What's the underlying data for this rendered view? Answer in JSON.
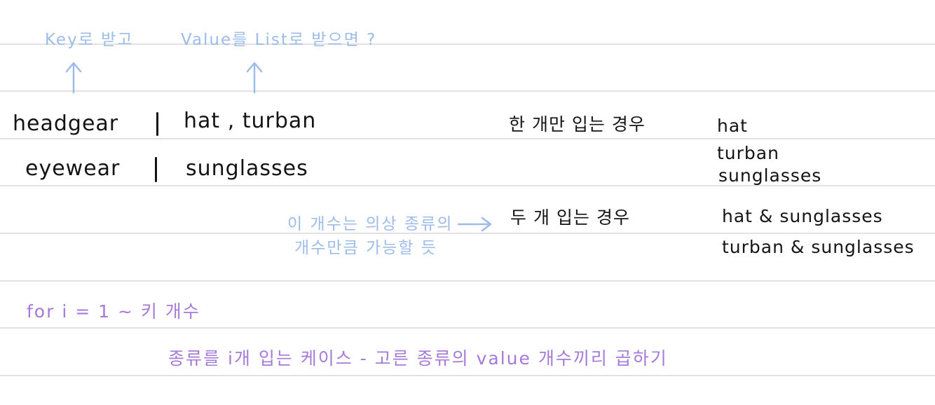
{
  "annotations": {
    "key_note": "Key로 받고",
    "value_note": "Value를 List로 받으면 ?",
    "count_note_line1": "이 개수는 의상 종류의",
    "count_note_line2": "개수만큼 가능할 듯"
  },
  "table": {
    "rows": [
      {
        "key": "headgear",
        "values": "hat , turban"
      },
      {
        "key": "eyewear",
        "values": "sunglasses"
      }
    ]
  },
  "cases": {
    "one_label": "한 개만 입는 경우",
    "one_items": [
      "hat",
      "turban",
      "sunglasses"
    ],
    "two_label": "두 개 입는 경우",
    "two_items": [
      "hat & sunglasses",
      "turban & sunglasses"
    ]
  },
  "loop": {
    "line1": "for i = 1 ~ 키 개수",
    "line2": "종류를 i개 입는 케이스 - 고른 종류의 value 개수끼리 곱하기"
  },
  "colors": {
    "ink": "#141414",
    "blue_note": "#9dbce8",
    "purple_note": "#a57ad8",
    "ruled_line": "#e2e2e2"
  }
}
